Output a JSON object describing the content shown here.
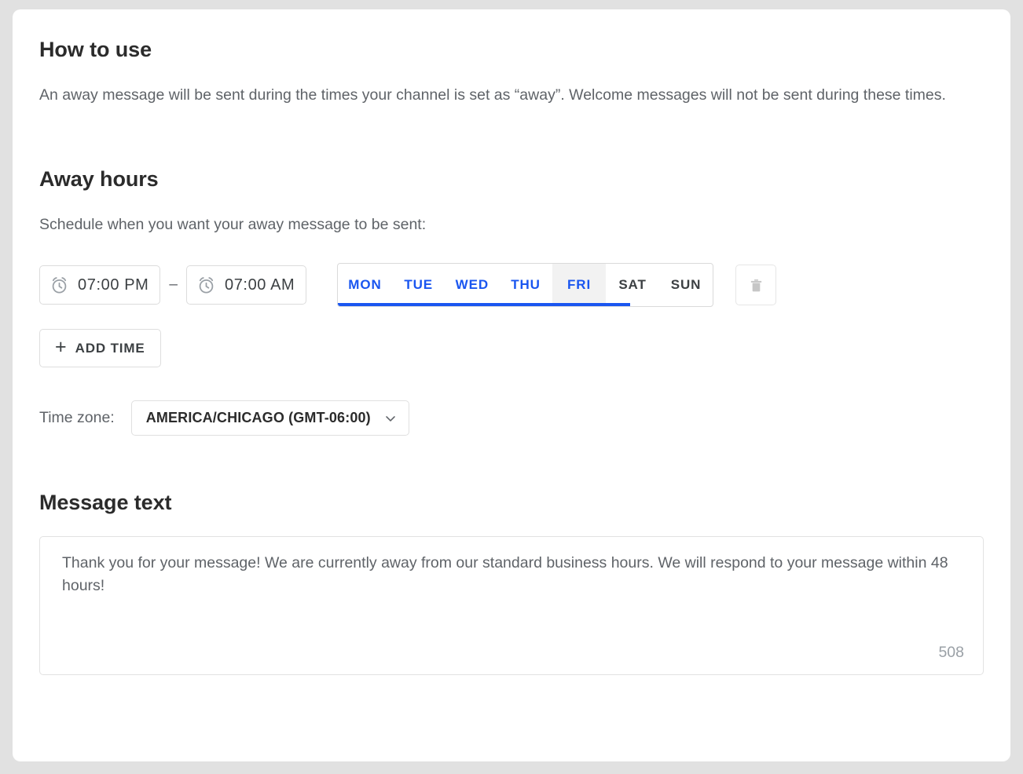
{
  "how_to_use": {
    "title": "How to use",
    "description": "An away message will be sent during the times your channel is set as “away”. Welcome messages will not be sent during these times."
  },
  "away_hours": {
    "title": "Away hours",
    "description": "Schedule when you want your away message to be sent:",
    "schedule": {
      "start_time": "07:00 PM",
      "end_time": "07:00 AM",
      "separator": "–",
      "start_icon": "alarm-clock-icon",
      "end_icon": "alarm-clock-icon",
      "days": [
        {
          "label": "MON",
          "selected": true,
          "hovered": false
        },
        {
          "label": "TUE",
          "selected": true,
          "hovered": false
        },
        {
          "label": "WED",
          "selected": true,
          "hovered": false
        },
        {
          "label": "THU",
          "selected": true,
          "hovered": false
        },
        {
          "label": "FRI",
          "selected": true,
          "hovered": true
        },
        {
          "label": "SAT",
          "selected": false,
          "hovered": false
        },
        {
          "label": "SUN",
          "selected": false,
          "hovered": false
        }
      ],
      "delete_icon": "trash-icon"
    },
    "add_time_button": {
      "plus": "+",
      "label": "ADD TIME"
    },
    "timezone": {
      "label": "Time zone:",
      "value": "AMERICA/CHICAGO (GMT-06:00)",
      "chevron_icon": "chevron-down-icon"
    }
  },
  "message_text": {
    "title": "Message text",
    "value": "Thank you for your message! We are currently away from our standard business hours. We will respond to your message within 48 hours!",
    "placeholder": "",
    "counter": "508"
  },
  "colors": {
    "accent_blue": "#1a56f0",
    "heading": "#2b2b2b",
    "body_text": "#5f6368",
    "muted": "#9aa0a6",
    "page_bg": "#e1e1e1",
    "card_bg": "#ffffff",
    "border": "#dcdcdc",
    "tab_hover_bg": "#f2f2f2"
  }
}
